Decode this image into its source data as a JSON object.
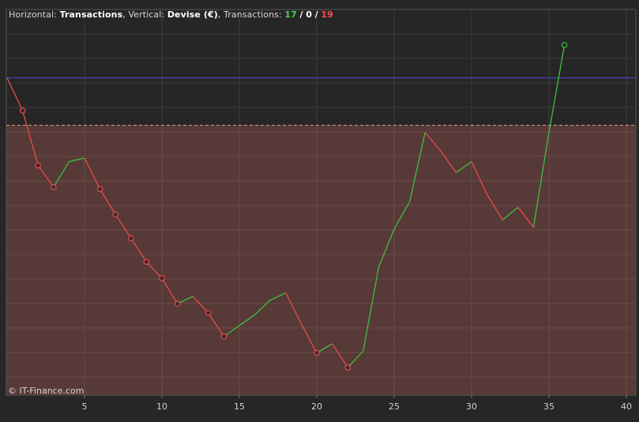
{
  "header": {
    "horizontal_label": "Horizontal:",
    "horizontal_value": "Transactions",
    "vertical_label": "Vertical:",
    "vertical_value": "Devise (€)",
    "transactions_label": "Transactions:",
    "wins": "17",
    "sep1": "/",
    "neutral": "0",
    "sep2": "/",
    "losses": "19"
  },
  "copyright": "© IT-Finance.com",
  "colors": {
    "background": "#262626",
    "drawdown_fill": "#5a3a38",
    "gain_line": "#3fbf3f",
    "loss_line": "#e84a4a",
    "high_water_line": "#4b4bd6",
    "threshold_line": "#d9a07a",
    "grid": "#3c3c3c"
  },
  "chart_data": {
    "type": "line",
    "xlabel": "Transactions",
    "ylabel": "Devise (€)",
    "xlim": [
      0,
      40.5
    ],
    "x_ticks": [
      5,
      10,
      15,
      20,
      25,
      30,
      35,
      40
    ],
    "ylim": [
      0,
      100
    ],
    "high_water_level": 86,
    "drawdown_threshold": 73,
    "series": [
      {
        "x": [
          0,
          1,
          2,
          3,
          4,
          5,
          6,
          7,
          8,
          9,
          10,
          11,
          12,
          13,
          14,
          15,
          16,
          17,
          18,
          19,
          20,
          21,
          22,
          23,
          24,
          25,
          26,
          27,
          28,
          29,
          30,
          31,
          32,
          33,
          34,
          35,
          36
        ],
        "y": [
          86,
          77,
          62,
          56,
          63,
          64,
          55.5,
          48.5,
          42,
          35.5,
          31,
          24,
          26,
          21.5,
          15,
          18,
          21,
          25,
          27,
          18.5,
          10.5,
          13,
          6.5,
          11,
          34,
          44.5,
          52,
          71,
          66,
          60,
          63,
          54,
          47,
          50.5,
          45,
          71,
          95
        ],
        "outcome": [
          "start",
          "loss",
          "loss",
          "loss",
          "gain",
          "gain",
          "loss",
          "loss",
          "loss",
          "loss",
          "loss",
          "loss",
          "gain",
          "loss",
          "loss",
          "gain",
          "gain",
          "gain",
          "gain",
          "loss",
          "loss",
          "gain",
          "loss",
          "gain",
          "gain",
          "gain",
          "gain",
          "gain",
          "loss",
          "loss",
          "gain",
          "loss",
          "loss",
          "gain",
          "loss",
          "gain",
          "gain"
        ],
        "marked": [
          1,
          2,
          3,
          6,
          7,
          8,
          9,
          10,
          11,
          13,
          14,
          20,
          22,
          36
        ]
      }
    ]
  }
}
